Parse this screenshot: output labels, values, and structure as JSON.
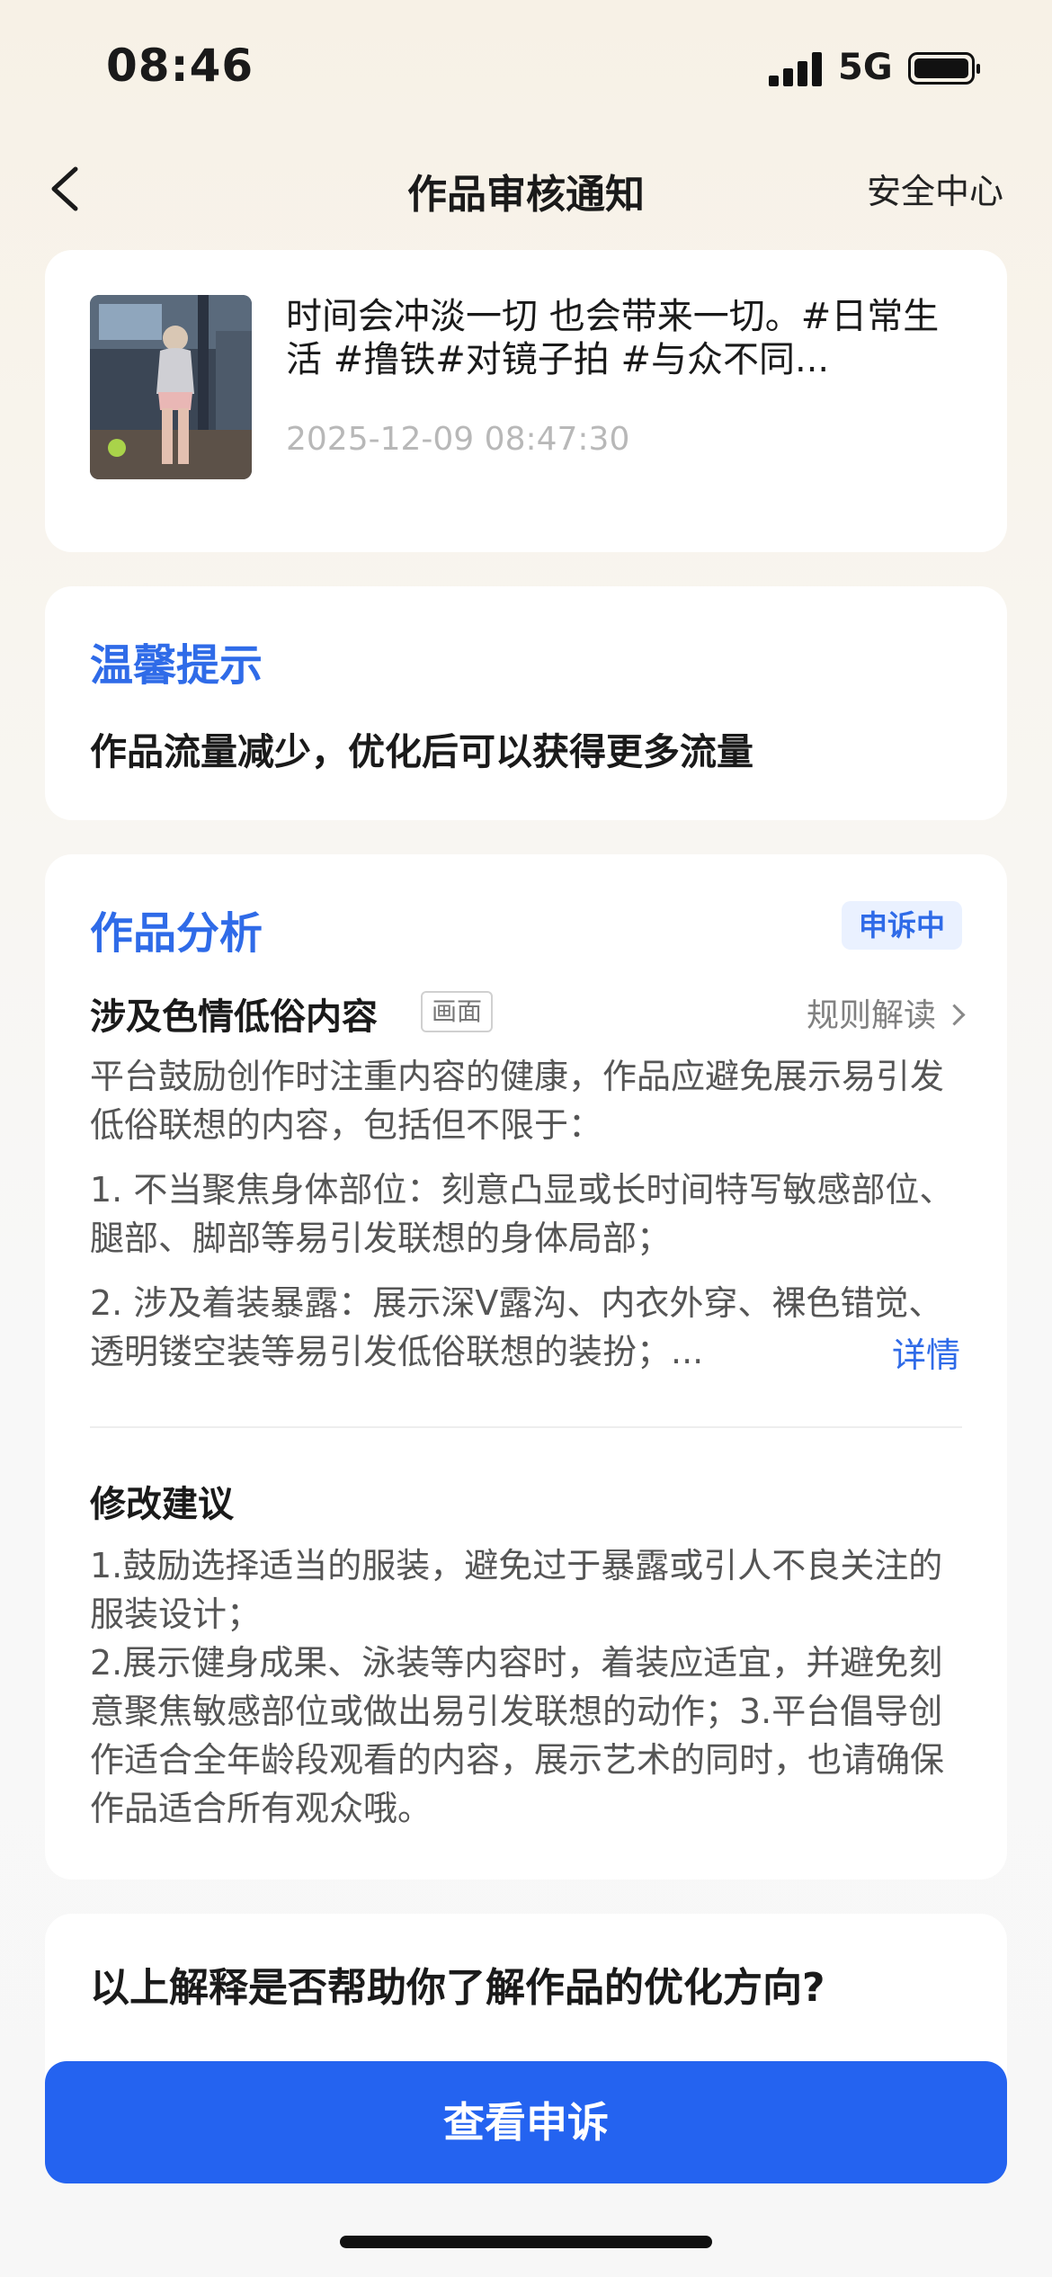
{
  "status_bar": {
    "time": "08:46",
    "network": "5G",
    "battery_level": 1.0
  },
  "nav": {
    "title": "作品审核通知",
    "right_link": "安全中心",
    "back_icon": "chevron-left-icon"
  },
  "post": {
    "title": "时间会冲淡一切 也会带来一切。#日常生活 #撸铁#对镜子拍 #与众不同...",
    "time": "2025-12-09 08:47:30",
    "thumbnail": "gym-mirror-photo"
  },
  "tip": {
    "heading": "温馨提示",
    "text": "作品流量减少，优化后可以获得更多流量"
  },
  "analysis": {
    "heading": "作品分析",
    "status_badge": "申诉中",
    "violation_title": "涉及色情低俗内容",
    "violation_tag": "画面",
    "rules_link": "规则解读",
    "intro": "平台鼓励创作时注重内容的健康，作品应避免展示易引发低俗联想的内容，包括但不限于：",
    "item1": "1. 不当聚焦身体部位：刻意凸显或长时间特写敏感部位、腿部、脚部等易引发联想的身体局部；",
    "item2": "2. 涉及着装暴露：展示深V露沟、内衣外穿、裸色错觉、透明镂空装等易引发低俗联想的装扮；...",
    "detail_link": "详情",
    "suggestion_heading": "修改建议",
    "suggestion_1": "1.鼓励选择适当的服装，避免过于暴露或引人不良关注的服装设计；",
    "suggestion_2": "2.展示健身成果、泳装等内容时，着装应适宜，并避免刻意聚焦敏感部位或做出易引发联想的动作；3.平台倡导创作适合全年龄段观看的内容，展示艺术的同时，也请确保作品适合所有观众哦。"
  },
  "feedback": {
    "question": "以上解释是否帮助你了解作品的优化方向?"
  },
  "primary_button": {
    "label": "查看申诉"
  },
  "colors": {
    "accent": "#2f6be8",
    "button": "#2463f0",
    "muted": "#b8b8b8"
  }
}
